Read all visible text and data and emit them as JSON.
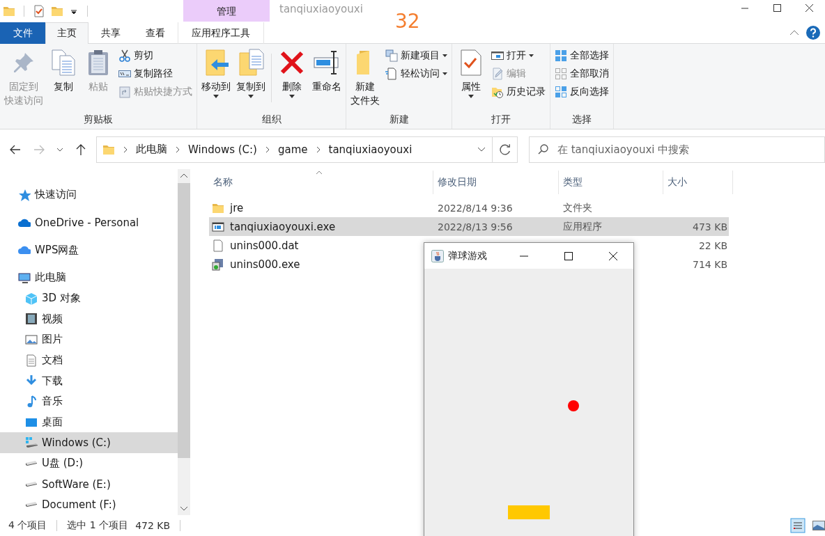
{
  "window": {
    "context_group": "管理",
    "title": "tanqiuxiaoyouxi",
    "overlay_number": "32"
  },
  "ribbon_tabs": [
    {
      "label": "文件",
      "kind": "file",
      "selected": false
    },
    {
      "label": "主页",
      "kind": "normal",
      "selected": true
    },
    {
      "label": "共享",
      "kind": "normal",
      "selected": false
    },
    {
      "label": "查看",
      "kind": "normal",
      "selected": false
    },
    {
      "label": "应用程序工具",
      "kind": "context",
      "selected": false
    }
  ],
  "ribbon_groups": [
    {
      "title": "剪贴板",
      "items": [
        {
          "kind": "large",
          "label_lines": [
            "固定到",
            "快速访问"
          ],
          "disabled": true,
          "dropdown": false
        },
        {
          "kind": "large",
          "label": "复制",
          "disabled": false,
          "dropdown": false
        },
        {
          "kind": "large",
          "label": "粘贴",
          "disabled": true,
          "dropdown": false
        },
        {
          "kind": "small",
          "label": "剪切",
          "disabled": false,
          "dropdown": false
        },
        {
          "kind": "small",
          "label": "复制路径",
          "disabled": false,
          "dropdown": false
        },
        {
          "kind": "small",
          "label": "粘贴快捷方式",
          "disabled": true,
          "dropdown": false
        }
      ]
    },
    {
      "title": "组织",
      "items": [
        {
          "kind": "large",
          "label": "移动到",
          "disabled": false,
          "dropdown": true
        },
        {
          "kind": "large",
          "label": "复制到",
          "disabled": false,
          "dropdown": true
        },
        {
          "kind": "separator"
        },
        {
          "kind": "large",
          "label": "删除",
          "disabled": false,
          "dropdown": true
        },
        {
          "kind": "large",
          "label": "重命名",
          "disabled": false,
          "dropdown": false
        }
      ]
    },
    {
      "title": "新建",
      "items": [
        {
          "kind": "large",
          "label_lines": [
            "新建",
            "文件夹"
          ],
          "disabled": false,
          "dropdown": false
        },
        {
          "kind": "small",
          "label": "新建项目",
          "disabled": false,
          "dropdown": true
        },
        {
          "kind": "small",
          "label": "轻松访问",
          "disabled": false,
          "dropdown": true
        }
      ]
    },
    {
      "title": "打开",
      "items": [
        {
          "kind": "large",
          "label": "属性",
          "disabled": false,
          "dropdown": true
        },
        {
          "kind": "small",
          "label": "打开",
          "disabled": false,
          "dropdown": true
        },
        {
          "kind": "small",
          "label": "编辑",
          "disabled": true,
          "dropdown": false
        },
        {
          "kind": "small",
          "label": "历史记录",
          "disabled": false,
          "dropdown": false
        }
      ]
    },
    {
      "title": "选择",
      "items": [
        {
          "kind": "small",
          "label": "全部选择",
          "disabled": false,
          "dropdown": false
        },
        {
          "kind": "small",
          "label": "全部取消",
          "disabled": false,
          "dropdown": false
        },
        {
          "kind": "small",
          "label": "反向选择",
          "disabled": false,
          "dropdown": false
        }
      ]
    }
  ],
  "address_bar": {
    "segments": [
      "此电脑",
      "Windows (C:)",
      "game",
      "tanqiuxiaoyouxi"
    ]
  },
  "search": {
    "placeholder": "在 tanqiuxiaoyouxi 中搜索"
  },
  "navigation": {
    "items": [
      {
        "label": "快速访问",
        "selected": false
      },
      {
        "label": "OneDrive - Personal",
        "selected": false
      },
      {
        "label": "WPS网盘",
        "selected": false
      },
      {
        "label": "此电脑",
        "selected": false,
        "children": [
          {
            "label": "3D 对象",
            "selected": false
          },
          {
            "label": "视频",
            "selected": false
          },
          {
            "label": "图片",
            "selected": false
          },
          {
            "label": "文档",
            "selected": false
          },
          {
            "label": "下载",
            "selected": false
          },
          {
            "label": "音乐",
            "selected": false
          },
          {
            "label": "桌面",
            "selected": false
          },
          {
            "label": "Windows (C:)",
            "selected": true
          },
          {
            "label": "U盘 (D:)",
            "selected": false
          },
          {
            "label": "SoftWare (E:)",
            "selected": false
          },
          {
            "label": "Document (F:)",
            "selected": false
          }
        ]
      }
    ]
  },
  "file_list": {
    "columns": [
      "名称",
      "修改日期",
      "类型",
      "大小"
    ],
    "rows": [
      {
        "name": "jre",
        "modified": "2022/8/14 9:36",
        "type": "文件夹",
        "selected": false
      },
      {
        "name": "tanqiuxiaoyouxi.exe",
        "modified": "2022/8/13 9:56",
        "type": "应用程序",
        "size": "473 KB",
        "selected": true
      },
      {
        "name": "unins000.dat",
        "size": "22 KB",
        "selected": false
      },
      {
        "name": "unins000.exe",
        "size": "714 KB",
        "selected": false
      }
    ]
  },
  "status_bar": {
    "item_count": "4 个项目",
    "selection": "选中 1 个项目",
    "selection_size": "472 KB"
  },
  "game_window": {
    "title": "弹球游戏"
  }
}
